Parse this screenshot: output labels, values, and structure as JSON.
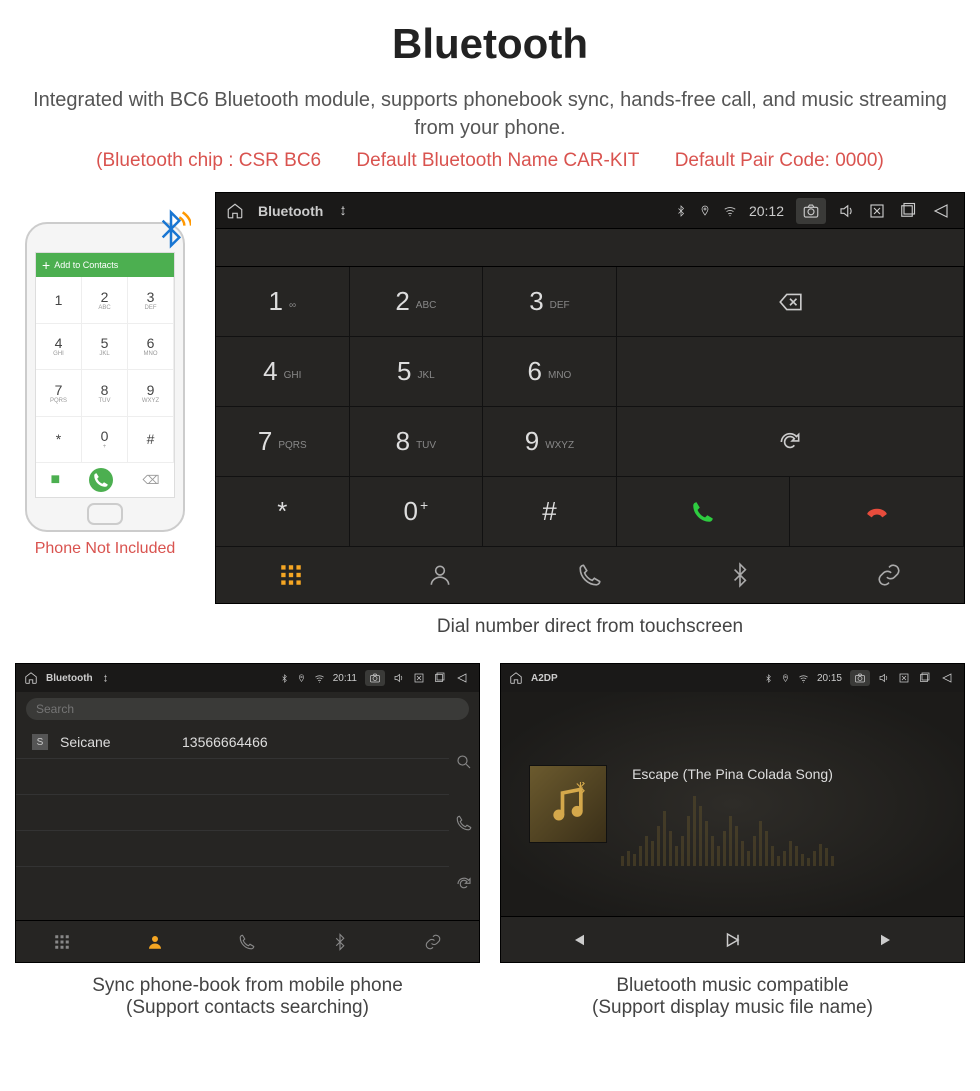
{
  "title": "Bluetooth",
  "subtitle": "Integrated with BC6 Bluetooth module, supports phonebook sync, hands-free call, and music streaming from your phone.",
  "specs": {
    "chip": "(Bluetooth chip : CSR BC6",
    "name": "Default Bluetooth Name CAR-KIT",
    "pair": "Default Pair Code: 0000)"
  },
  "phone": {
    "header": "Add to Contacts",
    "caption": "Phone Not Included",
    "keys": [
      {
        "n": "1",
        "l": ""
      },
      {
        "n": "2",
        "l": "ABC"
      },
      {
        "n": "3",
        "l": "DEF"
      },
      {
        "n": "4",
        "l": "GHI"
      },
      {
        "n": "5",
        "l": "JKL"
      },
      {
        "n": "6",
        "l": "MNO"
      },
      {
        "n": "7",
        "l": "PQRS"
      },
      {
        "n": "8",
        "l": "TUV"
      },
      {
        "n": "9",
        "l": "WXYZ"
      },
      {
        "n": "*",
        "l": ""
      },
      {
        "n": "0",
        "l": "+"
      },
      {
        "n": "#",
        "l": ""
      }
    ]
  },
  "main": {
    "statusbar": {
      "title": "Bluetooth",
      "time": "20:12"
    },
    "keys": [
      {
        "n": "1",
        "l": "∞"
      },
      {
        "n": "2",
        "l": "ABC"
      },
      {
        "n": "3",
        "l": "DEF"
      },
      {
        "n": "4",
        "l": "GHI"
      },
      {
        "n": "5",
        "l": "JKL"
      },
      {
        "n": "6",
        "l": "MNO"
      },
      {
        "n": "7",
        "l": "PQRS"
      },
      {
        "n": "8",
        "l": "TUV"
      },
      {
        "n": "9",
        "l": "WXYZ"
      },
      {
        "n": "*",
        "l": ""
      },
      {
        "n": "0",
        "l": "+"
      },
      {
        "n": "#",
        "l": ""
      }
    ],
    "caption": "Dial number direct from touchscreen"
  },
  "phonebook": {
    "statusbar": {
      "title": "Bluetooth",
      "time": "20:11"
    },
    "search_placeholder": "Search",
    "contact": {
      "badge": "S",
      "name": "Seicane",
      "number": "13566664466"
    },
    "caption1": "Sync phone-book from mobile phone",
    "caption2": "(Support contacts searching)"
  },
  "music": {
    "statusbar": {
      "title": "A2DP",
      "time": "20:15"
    },
    "song": "Escape (The Pina Colada Song)",
    "caption1": "Bluetooth music compatible",
    "caption2": "(Support display music file name)"
  }
}
